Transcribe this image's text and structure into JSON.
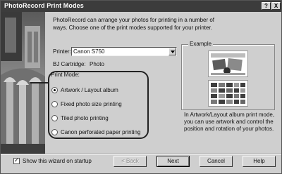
{
  "window": {
    "title": "PhotoRecord Print Modes",
    "help_glyph": "?",
    "close_glyph": "X"
  },
  "intro_text": "PhotoRecord can arrange your photos for printing in a number of ways. Choose one of the print modes supported for your printer.",
  "printer": {
    "label": "Printer:",
    "value": "Canon S750"
  },
  "cartridge": {
    "label": "BJ Cartridge:",
    "value": "Photo"
  },
  "print_mode": {
    "title": "Print Mode:",
    "options": [
      {
        "label": "Artwork / Layout album",
        "selected": true
      },
      {
        "label": "Fixed photo size printing",
        "selected": false
      },
      {
        "label": "Tiled photo printing",
        "selected": false
      },
      {
        "label": "Canon perforated paper printing",
        "selected": false
      }
    ]
  },
  "example": {
    "title": "Example",
    "description": "In Artwork/Layout album print mode, you can use artwork and control the position and rotation of your photos."
  },
  "footer": {
    "show_wizard_label": "Show this wizard on startup",
    "show_wizard_checked": true,
    "back_label": "< Back",
    "next_label": "Next",
    "cancel_label": "Cancel",
    "help_label": "Help"
  }
}
